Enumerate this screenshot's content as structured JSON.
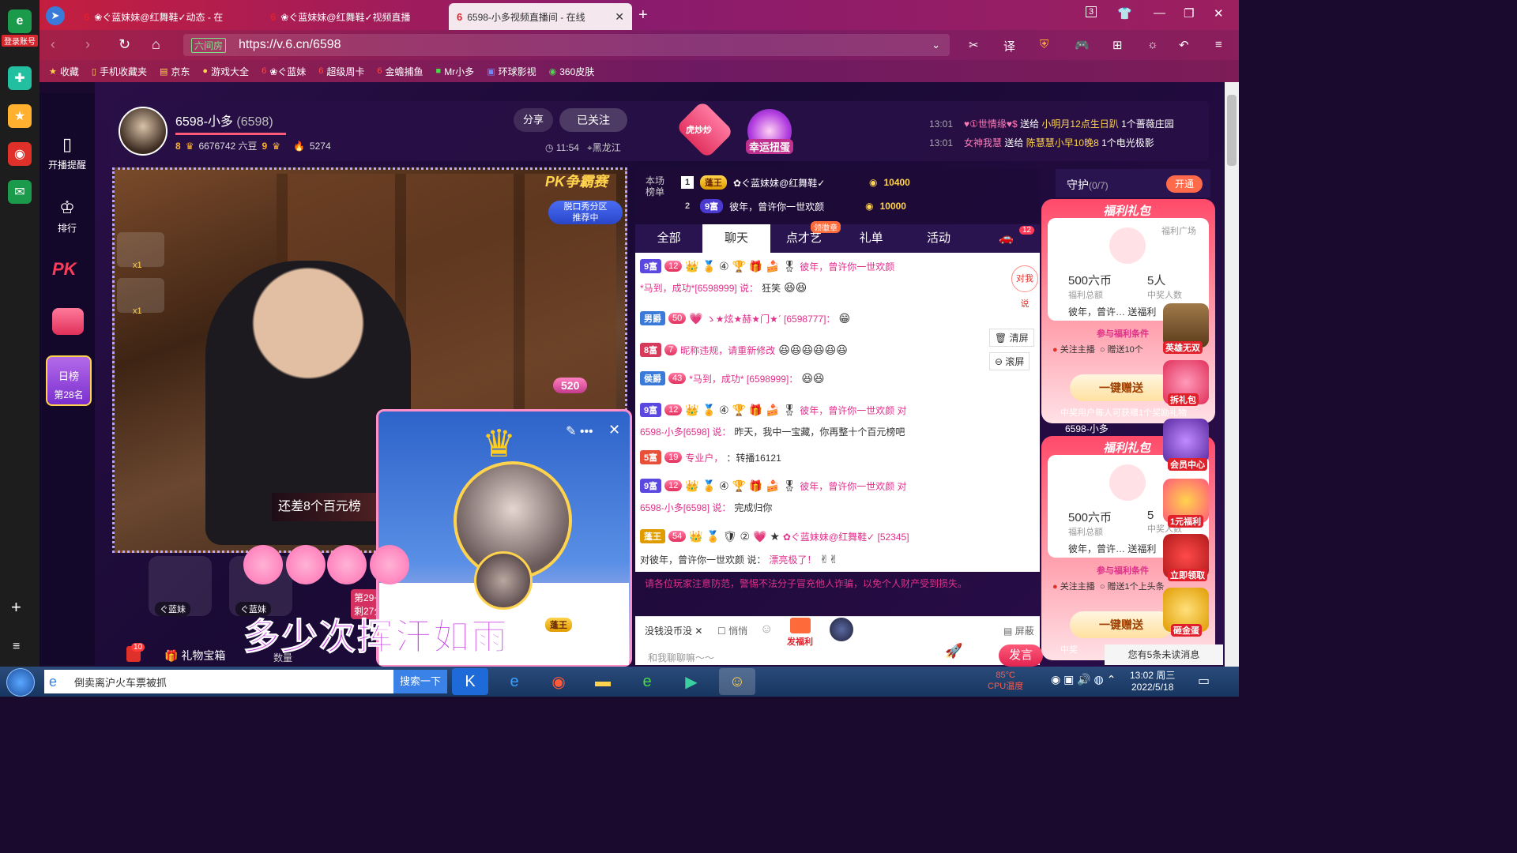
{
  "browser": {
    "tabs": [
      {
        "label": "❀ぐ蓝妹妹@红舞鞋✓动态 - 在"
      },
      {
        "label": "❀ぐ蓝妹妹@红舞鞋✓视频直播"
      },
      {
        "label": "6598-小多视频直播间 - 在线"
      }
    ],
    "url": "https://v.6.cn/6598",
    "secure_label": "六间房",
    "bookmarks": [
      "收藏",
      "手机收藏夹",
      "京东",
      "游戏大全",
      "❀ぐ蓝妹",
      "超级周卡",
      "金蟾捕鱼",
      "Mr小多",
      "环球影视",
      "360皮肤"
    ],
    "tab_count": "3"
  },
  "os_sidebar": {
    "login_label": "登录账号"
  },
  "site_nav": {
    "items": [
      "开播提醒",
      "排行"
    ],
    "day_rank_title": "日榜",
    "day_rank_value": "第28名"
  },
  "anchor": {
    "name": "6598-小多",
    "room_id": "(6598)",
    "level_a": "8",
    "beans": "6676742 六豆",
    "level_b": "9",
    "fire": "5274",
    "share": "分享",
    "follow": "已关注",
    "time": "11:54",
    "location": "黑龙江",
    "hp_badge": "虎炒炒",
    "lucky_egg": "幸运扭蛋"
  },
  "news": [
    {
      "time": "13:01",
      "from": "♥①世情缘♥$",
      "verb": "送给",
      "to": "小明月12点生日趴",
      "gift": "1个蔷薇庄园"
    },
    {
      "time": "13:01",
      "from": "女神我慧",
      "verb": "送给",
      "to": "陈慧慧小早10晚8",
      "gift": "1个电光极影"
    }
  ],
  "video": {
    "pk_banner": "PK争霸赛",
    "show_tag_line1": "脱口秀分区",
    "show_tag_line2": "推荐中",
    "hundred_text": "还差8个百元榜",
    "heart_520": "520",
    "side_gift_counts": [
      "x1",
      "x1"
    ],
    "lyric": "多少次挥汗如雨"
  },
  "seats": [
    {
      "name": "ぐ蓝妹"
    },
    {
      "name": "ぐ蓝妹"
    }
  ],
  "rank_side": {
    "line1": "第29+",
    "line2": "剩27分"
  },
  "bottom_bar": {
    "gift_box": "礼物宝箱",
    "gift_box_count": "10",
    "qty": "数量"
  },
  "ranking": {
    "title": "本场榜单",
    "rows": [
      {
        "no": "1",
        "badge": "蓬王",
        "name": "✿ぐ蓝妹妹@红舞鞋✓",
        "coins": "10400"
      },
      {
        "no": "2",
        "badge": "9富",
        "name": "彼年，曾许你一世欢颜",
        "coins": "10000"
      }
    ]
  },
  "chat": {
    "tabs": [
      "全部",
      "聊天",
      "点才艺",
      "礼单",
      "活动"
    ],
    "tab_badge": "领徽章",
    "car_badge": "12",
    "messages": [
      {
        "tag": "9富",
        "hp": "12",
        "name": "彼年，曾许你一世欢颜",
        "text": ""
      },
      {
        "tag": "",
        "hp": "",
        "name": "*马到，成功*[6598999] 说：",
        "text": "狂笑"
      },
      {
        "tag": "男爵",
        "hp": "50",
        "name": "ゝ★炫★赫★门★ˊ [6598777]：",
        "text": ""
      },
      {
        "tag": "8富",
        "hp": "7",
        "name": "昵称违规，请重新修改",
        "text": ""
      },
      {
        "tag": "侯爵",
        "hp": "43",
        "name": "*马到，成功* [6598999]：",
        "text": ""
      },
      {
        "tag": "9富",
        "hp": "12",
        "name": "彼年，曾许你一世欢颜 对",
        "text": ""
      },
      {
        "tag": "",
        "hp": "",
        "name": "6598-小多[6598] 说：",
        "text": "昨天，我中一宝藏，你再整十个百元榜吧"
      },
      {
        "tag": "5富",
        "hp": "19",
        "name": "专业户，",
        "text": "：转播16121"
      },
      {
        "tag": "9富",
        "hp": "12",
        "name": "彼年，曾许你一世欢颜 对",
        "text": ""
      },
      {
        "tag": "",
        "hp": "",
        "name": "6598-小多[6598] 说：",
        "text": "完成归你"
      },
      {
        "tag": "蓬王",
        "hp": "54",
        "name": "✿ぐ蓝妹妹@红舞鞋✓ [52345]",
        "text": ""
      },
      {
        "tag": "",
        "hp": "",
        "name": "对彼年，曾许你一世欢颜 说：",
        "text": "漂亮极了！"
      }
    ],
    "side_actions": [
      "清屏",
      "滚屏"
    ],
    "call_me": "对我说",
    "warning": "请各位玩家注意防范，警惕不法分子冒充他人诈骗，以免个人财产受到损失。",
    "input_text": "没钱没币没",
    "anon_label": "悄悄",
    "shield_label": "屏蔽",
    "fuli_label": "发福利",
    "placeholder": "和我聊聊嘛～～",
    "send": "发言"
  },
  "right_panel": {
    "guard_label": "守护",
    "guard_count": "(0/7)",
    "open_btn": "开通",
    "welfare": [
      {
        "title": "福利礼包",
        "plaza": "福利广场",
        "amount": "500六币",
        "amount_sub": "福利总额",
        "winners": "5人",
        "winners_sub": "中奖人数",
        "sender": "彼年，曾许…  送福利",
        "cond": "参与福利条件",
        "check1": "关注主播",
        "check2": "赠送10个",
        "send": "一键赠送",
        "note": "中奖用户每人可获赠1个奖励礼物"
      },
      {
        "title": "福利礼包",
        "plaza": "",
        "amount": "500六币",
        "amount_sub": "福利总额",
        "winners": "5",
        "winners_sub": "中奖人数",
        "sender": "彼年，曾许…  送福利",
        "cond": "参与福利条件",
        "check1": "关注主播",
        "check2": "赠送1个上头条",
        "send": "一键赠送",
        "note": "中奖"
      }
    ],
    "anchor_tag": "6598-小多",
    "side_icons": [
      "英雄无双",
      "拆礼包",
      "会员中心",
      "1元福利",
      "立即领取",
      "砸金蛋"
    ],
    "unread": "您有5条未读消息"
  },
  "taskbar": {
    "search_text": "倒卖离沪火车票被抓",
    "search_btn": "搜索一下",
    "temp_line1": "85°C",
    "temp_line2": "CPU温度",
    "time": "13:02 周三",
    "date": "2022/5/18"
  }
}
